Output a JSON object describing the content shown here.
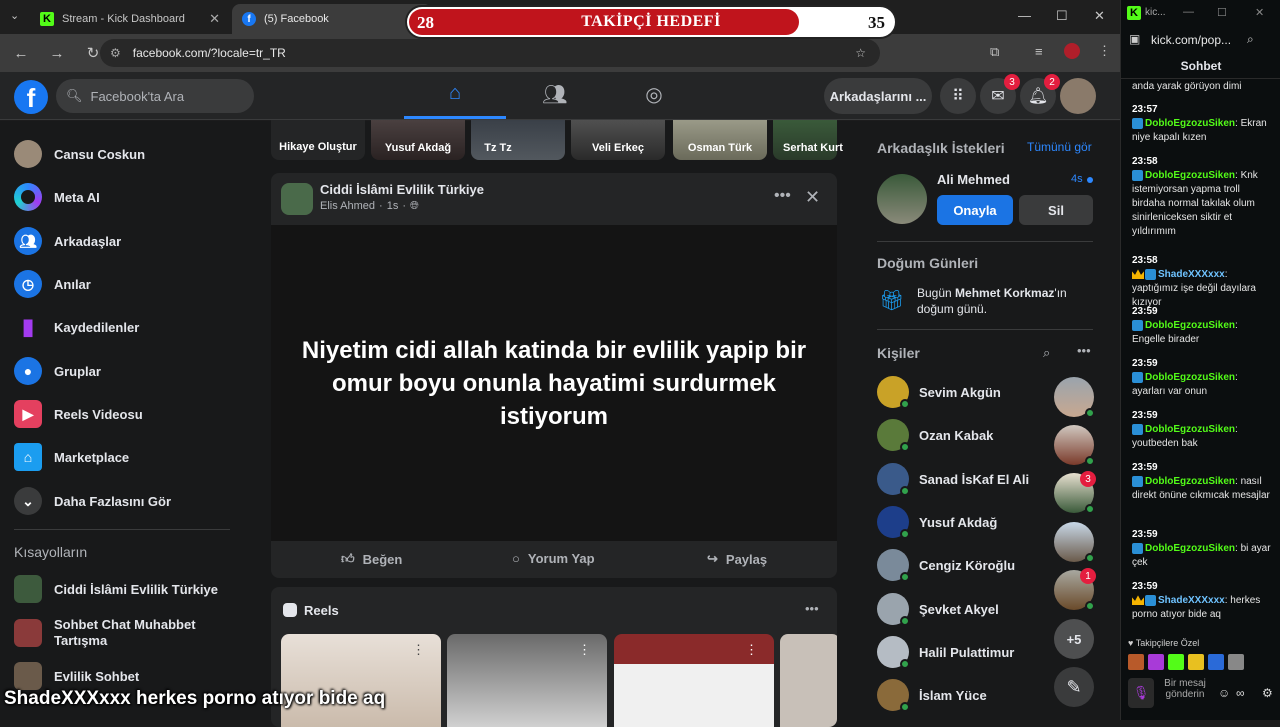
{
  "browser": {
    "tabs": [
      {
        "title": "Stream - Kick Dashboard"
      },
      {
        "title": "(5) Facebook"
      }
    ],
    "url": "facebook.com/?locale=tr_TR"
  },
  "goal": {
    "current": "28",
    "label": "TAKİPÇİ HEDEFİ",
    "target": "35",
    "progress": 0.8
  },
  "header": {
    "search_placeholder": "Facebook'ta Ara",
    "friends_button": "Arkadaşlarını ...",
    "messenger_badge": "3",
    "notif_badge": "2"
  },
  "left_nav": {
    "items": [
      {
        "label": "Cansu Coskun"
      },
      {
        "label": "Meta AI"
      },
      {
        "label": "Arkadaşlar"
      },
      {
        "label": "Anılar"
      },
      {
        "label": "Kaydedilenler"
      },
      {
        "label": "Gruplar"
      },
      {
        "label": "Reels Videosu"
      },
      {
        "label": "Marketplace"
      },
      {
        "label": "Daha Fazlasını Gör"
      }
    ],
    "shortcuts_title": "Kısayolların",
    "shortcuts": [
      {
        "label": "Ciddi İslâmi Evlilik Türkiye"
      },
      {
        "label": "Sohbet Chat Muhabbet Tartışma"
      },
      {
        "label": "Evlilik Sohbet"
      }
    ]
  },
  "stories": [
    {
      "label": "Hikaye Oluştur"
    },
    {
      "label": "Yusuf Akdağ"
    },
    {
      "label": "Tz Tz"
    },
    {
      "label": "Veli Erkeç"
    },
    {
      "label": "Osman Türk"
    },
    {
      "label": "Serhat Kurt"
    }
  ],
  "post": {
    "group": "Ciddi İslâmi Evlilik Türkiye",
    "author": "Elis Ahmed",
    "time": "1s",
    "text": "Niyetim cidi allah katinda bir evlilik yapip bir omur boyu onunla hayatimi surdurmek istiyorum",
    "like": "Beğen",
    "comment": "Yorum Yap",
    "share": "Paylaş"
  },
  "reels": {
    "title": "Reels"
  },
  "right": {
    "requests_title": "Arkadaşlık İstekleri",
    "see_all": "Tümünü gör",
    "request": {
      "name": "Ali Mehmed",
      "time": "4s",
      "confirm": "Onayla",
      "delete": "Sil"
    },
    "birthdays_title": "Doğum Günleri",
    "birthday_prefix": "Bugün ",
    "birthday_name": "Mehmet Korkmaz",
    "birthday_suffix": "'ın doğum günü.",
    "contacts_title": "Kişiler",
    "contacts": [
      {
        "name": "Sevim Akgün",
        "color": "#c9a227"
      },
      {
        "name": "Ozan Kabak",
        "color": "#5a7a3a"
      },
      {
        "name": "Sanad İsKaf El Ali",
        "color": "#3a5a8a"
      },
      {
        "name": "Yusuf Akdağ",
        "color": "#1d3e8a"
      },
      {
        "name": "Cengiz Köroğlu",
        "color": "#7a8a9a"
      },
      {
        "name": "Şevket Akyel",
        "color": "#9aa4ad"
      },
      {
        "name": "Halil Pulattimur",
        "color": "#b5bcc4"
      },
      {
        "name": "İslam Yüce",
        "color": "#8a6a3a"
      }
    ],
    "chatheads_badges": {
      "third": "3",
      "sixth": "1"
    },
    "more_heads": "+5"
  },
  "chat": {
    "url": "kick.com/pop...",
    "title": "Sohbet",
    "messages": [
      {
        "time": "",
        "user": "",
        "text": "anda yarak görüyon dimi"
      },
      {
        "time": "23:57",
        "user": "DobloEgzozuSiken",
        "text": "Ekran niye kapalı kızen"
      },
      {
        "time": "23:58",
        "user": "DobloEgzozuSiken",
        "text": "Knk istemiyorsan yapma troll birdaha normal takılak olum sinirleniceksen siktir et yıldırımım"
      },
      {
        "time": "23:58",
        "user": "ShadeXXXxxx",
        "text": "yaptığımız işe değil dayılara kızıyor"
      },
      {
        "time": "23:59",
        "user": "DobloEgzozuSiken",
        "text": "Engelle birader"
      },
      {
        "time": "23:59",
        "user": "DobloEgzozuSiken",
        "text": "ayarları var onun"
      },
      {
        "time": "23:59",
        "user": "DobloEgzozuSiken",
        "text": "youtbeden bak"
      },
      {
        "time": "23:59",
        "user": "DobloEgzozuSiken",
        "text": "nasıl direkt önüne cıkmıcak mesajlar"
      },
      {
        "time": "23:59",
        "user": "DobloEgzozuSiken",
        "text": "bi ayar çek"
      },
      {
        "time": "23:59",
        "user": "ShadeXXXxxx",
        "text": "herkes porno atıyor bide aq"
      }
    ],
    "followers_only": "Takipçilere Özel",
    "input_placeholder": "Bir mesaj gönderin"
  },
  "caption": {
    "user": "ShadeXXXxxx",
    "text": "herkes porno atıyor bide aq"
  }
}
